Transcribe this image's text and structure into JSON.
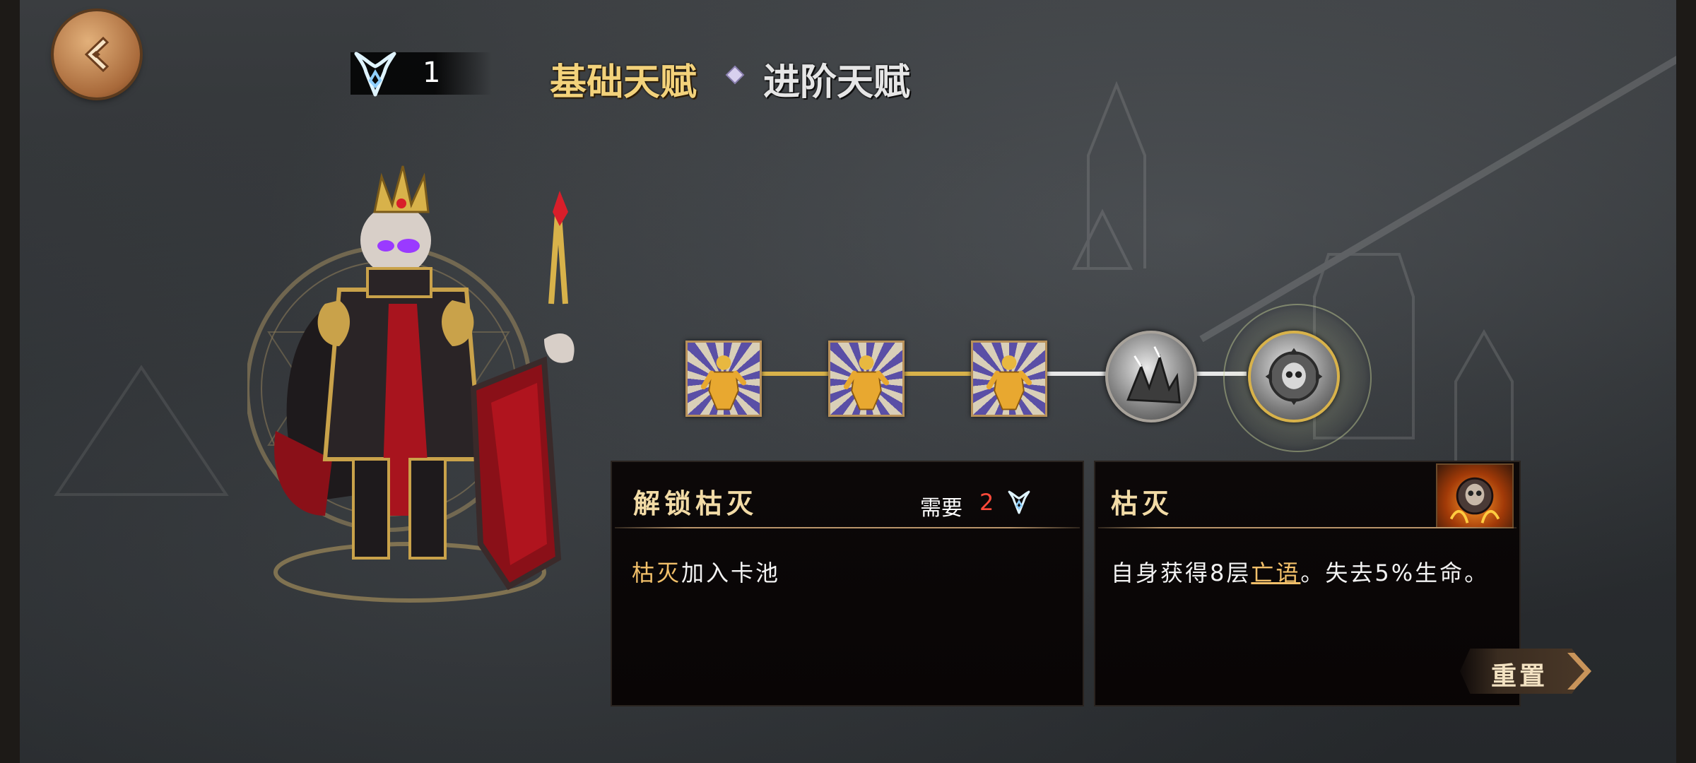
{
  "header": {
    "talent_points": "1",
    "tabs": [
      {
        "label": "基础天赋",
        "active": true
      },
      {
        "label": "进阶天赋",
        "active": false
      }
    ]
  },
  "talent_tree": {
    "nodes": [
      {
        "icon": "golden-figure-icon",
        "shape": "square",
        "unlocked": true
      },
      {
        "icon": "golden-figure-icon",
        "shape": "square",
        "unlocked": true
      },
      {
        "icon": "golden-figure-icon",
        "shape": "square",
        "unlocked": true
      },
      {
        "icon": "crystal-shard-icon",
        "shape": "circle",
        "unlocked": false
      },
      {
        "icon": "skull-sawblade-icon",
        "shape": "circle",
        "unlocked": false,
        "selected": true
      }
    ]
  },
  "unlock_panel": {
    "title": "解锁枯灭",
    "require_label": "需要",
    "require_count": "2",
    "desc_highlight": "枯灭",
    "desc_rest": "加入卡池"
  },
  "skill_panel": {
    "title": "枯灭",
    "desc_before": "自身获得8层",
    "desc_link": "亡语",
    "desc_after": "。失去5%生命。"
  },
  "reset_button": {
    "label": "重置"
  },
  "colors": {
    "gold_text": "#f3d27b",
    "highlight": "#f2c06a",
    "require_red": "#ff4a3a",
    "line_active": "#d8b24a",
    "line_inactive": "#e8e8e8"
  }
}
